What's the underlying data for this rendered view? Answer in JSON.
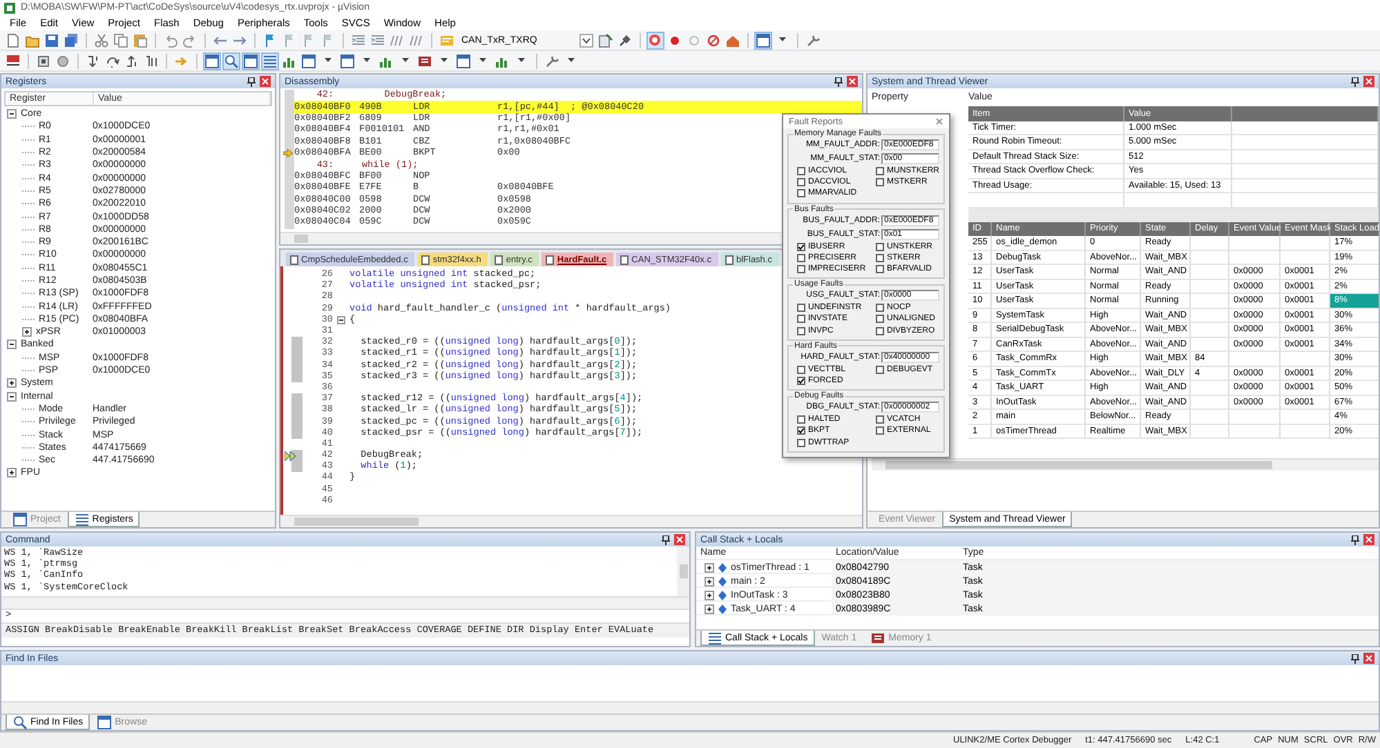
{
  "window": {
    "title": "D:\\MOBA\\SW\\FW\\PM-PT\\act\\CoDeSys\\source\\uV4\\codesys_rtx.uvprojx - µVision"
  },
  "menu": [
    "File",
    "Edit",
    "View",
    "Project",
    "Flash",
    "Debug",
    "Peripherals",
    "Tools",
    "SVCS",
    "Window",
    "Help"
  ],
  "toolbar": {
    "target": "CAN_TxR_TXRQ"
  },
  "registers": {
    "title": "Registers",
    "columns": [
      "Register",
      "Value"
    ],
    "groups": [
      {
        "name": "Core",
        "expanded": true,
        "children": [
          {
            "name": "R0",
            "value": "0x1000DCE0"
          },
          {
            "name": "R1",
            "value": "0x00000001"
          },
          {
            "name": "R2",
            "value": "0x20000584"
          },
          {
            "name": "R3",
            "value": "0x00000000"
          },
          {
            "name": "R4",
            "value": "0x00000000"
          },
          {
            "name": "R5",
            "value": "0x02780000"
          },
          {
            "name": "R6",
            "value": "0x20022010"
          },
          {
            "name": "R7",
            "value": "0x1000DD58"
          },
          {
            "name": "R8",
            "value": "0x00000000"
          },
          {
            "name": "R9",
            "value": "0x200161BC"
          },
          {
            "name": "R10",
            "value": "0x00000000"
          },
          {
            "name": "R11",
            "value": "0x080455C1"
          },
          {
            "name": "R12",
            "value": "0x0804503B"
          },
          {
            "name": "R13 (SP)",
            "value": "0x1000FDF8"
          },
          {
            "name": "R14 (LR)",
            "value": "0xFFFFFFED"
          },
          {
            "name": "R15 (PC)",
            "value": "0x08040BFA"
          },
          {
            "name": "xPSR",
            "value": "0x01000003",
            "expanded": false
          }
        ]
      },
      {
        "name": "Banked",
        "expanded": true,
        "children": [
          {
            "name": "MSP",
            "value": "0x1000FDF8"
          },
          {
            "name": "PSP",
            "value": "0x1000DCE0"
          }
        ]
      },
      {
        "name": "System",
        "expanded": false
      },
      {
        "name": "Internal",
        "expanded": true,
        "children": [
          {
            "name": "Mode",
            "value": "Handler"
          },
          {
            "name": "Privilege",
            "value": "Privileged"
          },
          {
            "name": "Stack",
            "value": "MSP"
          },
          {
            "name": "States",
            "value": "4474175669"
          },
          {
            "name": "Sec",
            "value": "447.41756690"
          }
        ]
      },
      {
        "name": "FPU",
        "expanded": false
      }
    ],
    "tabs": [
      {
        "label": "Project",
        "selected": false
      },
      {
        "label": "Registers",
        "selected": true
      }
    ]
  },
  "disassembly": {
    "title": "Disassembly",
    "lines": [
      {
        "kind": "source",
        "text": "    42:         DebugBreak;"
      },
      {
        "kind": "instruction",
        "address": "0x08040BF0",
        "opcode": "490B",
        "mnemonic": "LDR",
        "operands": "r1,[pc,#44]  ; @0x08040C20",
        "highlighted": true,
        "current": false
      },
      {
        "kind": "instruction",
        "address": "0x08040BF2",
        "opcode": "6809",
        "mnemonic": "LDR",
        "operands": "r1,[r1,#0x00]",
        "highlighted": false,
        "current": false
      },
      {
        "kind": "instruction",
        "address": "0x08040BF4",
        "opcode": "F0010101",
        "mnemonic": "AND",
        "operands": "r1,r1,#0x01",
        "highlighted": false,
        "current": false
      },
      {
        "kind": "instruction",
        "address": "0x08040BF8",
        "opcode": "B101",
        "mnemonic": "CBZ",
        "operands": "r1,0x08040BFC",
        "highlighted": false,
        "current": false
      },
      {
        "kind": "instruction",
        "address": "0x08040BFA",
        "opcode": "BE00",
        "mnemonic": "BKPT",
        "operands": "0x00",
        "highlighted": false,
        "current": true
      },
      {
        "kind": "source",
        "text": "    43:     while (1);"
      },
      {
        "kind": "instruction",
        "address": "0x08040BFC",
        "opcode": "BF00",
        "mnemonic": "NOP",
        "highlighted": false,
        "current": false
      },
      {
        "kind": "instruction",
        "address": "0x08040BFE",
        "opcode": "E7FE",
        "mnemonic": "B",
        "operands": "0x08040BFE",
        "highlighted": false,
        "current": false
      },
      {
        "kind": "instruction",
        "address": "0x08040C00",
        "opcode": "0598",
        "mnemonic": "DCW",
        "operands": "0x0598",
        "highlighted": false,
        "current": false
      },
      {
        "kind": "instruction",
        "address": "0x08040C02",
        "opcode": "2000",
        "mnemonic": "DCW",
        "operands": "0x2000",
        "highlighted": false,
        "current": false
      },
      {
        "kind": "instruction",
        "address": "0x08040C04",
        "opcode": "059C",
        "mnemonic": "DCW",
        "operands": "0x059C",
        "highlighted": false,
        "current": false
      }
    ]
  },
  "editor": {
    "tabs": [
      {
        "label": "CmpScheduleEmbedded.c",
        "color": "#c9d0ea",
        "selected": false
      },
      {
        "label": "stm32f4xx.h",
        "color": "#f6dc7e",
        "selected": false
      },
      {
        "label": "entry.c",
        "color": "#cfe2bd",
        "selected": false
      },
      {
        "label": "HardFault.c",
        "color": "#f0b4b4",
        "selected": true
      },
      {
        "label": "CAN_STM32F40x.c",
        "color": "#d9c9ea",
        "selected": false
      },
      {
        "label": "blFlash.c",
        "color": "#c8e4e0",
        "selected": false
      }
    ],
    "lines": [
      {
        "number": "26",
        "segments": [
          {
            "text": "volatile unsigned int",
            "kind": "keyword"
          },
          {
            "text": " stacked_pc;",
            "kind": "plain"
          }
        ],
        "executed": false,
        "current": false,
        "fold": false
      },
      {
        "number": "27",
        "segments": [
          {
            "text": "volatile unsigned int",
            "kind": "keyword"
          },
          {
            "text": " stacked_psr;",
            "kind": "plain"
          }
        ],
        "executed": false,
        "current": false,
        "fold": false
      },
      {
        "number": "28",
        "executed": false,
        "current": false,
        "fold": false
      },
      {
        "number": "29",
        "segments": [
          {
            "text": "void",
            "kind": "keyword"
          },
          {
            "text": " hard_fault_handler_c (",
            "kind": "plain"
          },
          {
            "text": "unsigned int",
            "kind": "keyword"
          },
          {
            "text": " * hardfault_args)",
            "kind": "plain"
          }
        ],
        "executed": false,
        "current": false,
        "fold": false
      },
      {
        "number": "30",
        "segments": [
          {
            "text": "{",
            "kind": "plain"
          }
        ],
        "executed": false,
        "current": false,
        "fold": true
      },
      {
        "number": "31",
        "executed": false,
        "current": false,
        "fold": false
      },
      {
        "number": "32",
        "segments": [
          {
            "text": "  stacked_r0 = ((",
            "kind": "plain"
          },
          {
            "text": "unsigned long",
            "kind": "keyword"
          },
          {
            "text": ") hardfault_args[",
            "kind": "plain"
          },
          {
            "text": "0",
            "kind": "number"
          },
          {
            "text": "]);",
            "kind": "plain"
          }
        ],
        "executed": true,
        "current": false,
        "fold": false
      },
      {
        "number": "33",
        "segments": [
          {
            "text": "  stacked_r1 = ((",
            "kind": "plain"
          },
          {
            "text": "unsigned long",
            "kind": "keyword"
          },
          {
            "text": ") hardfault_args[",
            "kind": "plain"
          },
          {
            "text": "1",
            "kind": "number"
          },
          {
            "text": "]);",
            "kind": "plain"
          }
        ],
        "executed": true,
        "current": false,
        "fold": false
      },
      {
        "number": "34",
        "segments": [
          {
            "text": "  stacked_r2 = ((",
            "kind": "plain"
          },
          {
            "text": "unsigned long",
            "kind": "keyword"
          },
          {
            "text": ") hardfault_args[",
            "kind": "plain"
          },
          {
            "text": "2",
            "kind": "number"
          },
          {
            "text": "]);",
            "kind": "plain"
          }
        ],
        "executed": true,
        "current": false,
        "fold": false
      },
      {
        "number": "35",
        "segments": [
          {
            "text": "  stacked_r3 = ((",
            "kind": "plain"
          },
          {
            "text": "unsigned long",
            "kind": "keyword"
          },
          {
            "text": ") hardfault_args[",
            "kind": "plain"
          },
          {
            "text": "3",
            "kind": "number"
          },
          {
            "text": "]);",
            "kind": "plain"
          }
        ],
        "executed": true,
        "current": false,
        "fold": false
      },
      {
        "number": "36",
        "executed": false,
        "current": false,
        "fold": false
      },
      {
        "number": "37",
        "segments": [
          {
            "text": "  stacked_r12 = ((",
            "kind": "plain"
          },
          {
            "text": "unsigned long",
            "kind": "keyword"
          },
          {
            "text": ") hardfault_args[",
            "kind": "plain"
          },
          {
            "text": "4",
            "kind": "number"
          },
          {
            "text": "]);",
            "kind": "plain"
          }
        ],
        "executed": true,
        "current": false,
        "fold": false
      },
      {
        "number": "38",
        "segments": [
          {
            "text": "  stacked_lr = ((",
            "kind": "plain"
          },
          {
            "text": "unsigned long",
            "kind": "keyword"
          },
          {
            "text": ") hardfault_args[",
            "kind": "plain"
          },
          {
            "text": "5",
            "kind": "number"
          },
          {
            "text": "]);",
            "kind": "plain"
          }
        ],
        "executed": true,
        "current": false,
        "fold": false
      },
      {
        "number": "39",
        "segments": [
          {
            "text": "  stacked_pc = ((",
            "kind": "plain"
          },
          {
            "text": "unsigned long",
            "kind": "keyword"
          },
          {
            "text": ") hardfault_args[",
            "kind": "plain"
          },
          {
            "text": "6",
            "kind": "number"
          },
          {
            "text": "]);",
            "kind": "plain"
          }
        ],
        "executed": true,
        "current": false,
        "fold": false
      },
      {
        "number": "40",
        "segments": [
          {
            "text": "  stacked_psr = ((",
            "kind": "plain"
          },
          {
            "text": "unsigned long",
            "kind": "keyword"
          },
          {
            "text": ") hardfault_args[",
            "kind": "plain"
          },
          {
            "text": "7",
            "kind": "number"
          },
          {
            "text": "]);",
            "kind": "plain"
          }
        ],
        "executed": true,
        "current": false,
        "fold": false
      },
      {
        "number": "41",
        "executed": false,
        "current": false,
        "fold": false
      },
      {
        "number": "42",
        "segments": [
          {
            "text": "  DebugBreak;",
            "kind": "plain"
          }
        ],
        "executed": true,
        "current": true,
        "fold": false
      },
      {
        "number": "43",
        "segments": [
          {
            "text": "  while",
            "kind": "keyword"
          },
          {
            "text": " (",
            "kind": "plain"
          },
          {
            "text": "1",
            "kind": "number"
          },
          {
            "text": ");",
            "kind": "plain"
          }
        ],
        "executed": true,
        "current": false,
        "fold": false
      },
      {
        "number": "44",
        "segments": [
          {
            "text": "}",
            "kind": "plain"
          }
        ],
        "executed": false,
        "current": false,
        "fold": false
      },
      {
        "number": "45",
        "executed": false,
        "current": false,
        "fold": false
      },
      {
        "number": "46",
        "executed": false,
        "current": false,
        "fold": false
      }
    ]
  },
  "fault_reports": {
    "title": "Fault Reports",
    "groups": [
      {
        "title": "Memory Manage Faults",
        "registers": [
          {
            "label": "MM_FAULT_ADDR:",
            "value": "0xE000EDF8"
          },
          {
            "label": "MM_FAULT_STAT:",
            "value": "0x00"
          }
        ],
        "flags": [
          {
            "label": "IACCVIOL",
            "checked": false
          },
          {
            "label": "MUNSTKERR",
            "checked": false
          },
          {
            "label": "DACCVIOL",
            "checked": false
          },
          {
            "label": "MSTKERR",
            "checked": false
          },
          {
            "label": "MMARVALID",
            "checked": false
          }
        ]
      },
      {
        "title": "Bus Faults",
        "registers": [
          {
            "label": "BUS_FAULT_ADDR:",
            "value": "0xE000EDF8"
          },
          {
            "label": "BUS_FAULT_STAT:",
            "value": "0x01"
          }
        ],
        "flags": [
          {
            "label": "IBUSERR",
            "checked": true
          },
          {
            "label": "UNSTKERR",
            "checked": false
          },
          {
            "label": "PRECISERR",
            "checked": false
          },
          {
            "label": "STKERR",
            "checked": false
          },
          {
            "label": "IMPRECISERR",
            "checked": false
          },
          {
            "label": "BFARVALID",
            "checked": false
          }
        ]
      },
      {
        "title": "Usage Faults",
        "registers": [
          {
            "label": "USG_FAULT_STAT:",
            "value": "0x0000"
          }
        ],
        "flags": [
          {
            "label": "UNDEFINSTR",
            "checked": false
          },
          {
            "label": "NOCP",
            "checked": false
          },
          {
            "label": "INVSTATE",
            "checked": false
          },
          {
            "label": "UNALIGNED",
            "checked": false
          },
          {
            "label": "INVPC",
            "checked": false
          },
          {
            "label": "DIVBYZERO",
            "checked": false
          }
        ]
      },
      {
        "title": "Hard Faults",
        "registers": [
          {
            "label": "HARD_FAULT_STAT:",
            "value": "0x40000000"
          }
        ],
        "flags": [
          {
            "label": "VECTTBL",
            "checked": false
          },
          {
            "label": "DEBUGEVT",
            "checked": false
          },
          {
            "label": "FORCED",
            "checked": true
          }
        ]
      },
      {
        "title": "Debug Faults",
        "registers": [
          {
            "label": "DBG_FAULT_STAT:",
            "value": "0x00000002"
          }
        ],
        "flags": [
          {
            "label": "HALTED",
            "checked": false
          },
          {
            "label": "VCATCH",
            "checked": false
          },
          {
            "label": "BKPT",
            "checked": true
          },
          {
            "label": "EXTERNAL",
            "checked": false
          },
          {
            "label": "DWTTRAP",
            "checked": false
          }
        ]
      }
    ]
  },
  "thread_viewer": {
    "title": "System and Thread Viewer",
    "columns": [
      "Property",
      "Value"
    ],
    "system": {
      "columns": [
        "Item",
        "Value"
      ],
      "rows": [
        {
          "item": "Tick Timer:",
          "value": "1.000 mSec"
        },
        {
          "item": "Round Robin Timeout:",
          "value": "5.000 mSec"
        },
        {
          "item": "Default Thread Stack Size:",
          "value": "512"
        },
        {
          "item": "Thread Stack Overflow Check:",
          "value": "Yes"
        },
        {
          "item": "Thread Usage:",
          "value": "Available: 15, Used: 13"
        }
      ]
    },
    "threads": {
      "columns": [
        "ID",
        "Name",
        "Priority",
        "State",
        "Delay",
        "Event Value",
        "Event Mask",
        "Stack Load"
      ],
      "rows": [
        {
          "id": "255",
          "name": "os_idle_demon",
          "priority": "0",
          "state": "Ready",
          "stack_load": "17%",
          "highlighted": false
        },
        {
          "id": "13",
          "name": "DebugTask",
          "priority": "AboveNor...",
          "state": "Wait_MBX",
          "stack_load": "19%",
          "highlighted": false
        },
        {
          "id": "12",
          "name": "UserTask",
          "priority": "Normal",
          "state": "Wait_AND",
          "event_value": "0x0000",
          "event_mask": "0x0001",
          "stack_load": "2%",
          "highlighted": false
        },
        {
          "id": "11",
          "name": "UserTask",
          "priority": "Normal",
          "state": "Ready",
          "event_value": "0x0000",
          "event_mask": "0x0001",
          "stack_load": "2%",
          "highlighted": false
        },
        {
          "id": "10",
          "name": "UserTask",
          "priority": "Normal",
          "state": "Running",
          "event_value": "0x0000",
          "event_mask": "0x0001",
          "stack_load": "8%",
          "highlighted": true
        },
        {
          "id": "9",
          "name": "SystemTask",
          "priority": "High",
          "state": "Wait_AND",
          "event_value": "0x0000",
          "event_mask": "0x0001",
          "stack_load": "30%",
          "highlighted": false
        },
        {
          "id": "8",
          "name": "SerialDebugTask",
          "priority": "AboveNor...",
          "state": "Wait_MBX",
          "event_value": "0x0000",
          "event_mask": "0x0001",
          "stack_load": "36%",
          "highlighted": false
        },
        {
          "id": "7",
          "name": "CanRxTask",
          "priority": "AboveNor...",
          "state": "Wait_AND",
          "event_value": "0x0000",
          "event_mask": "0x0001",
          "stack_load": "34%",
          "highlighted": false
        },
        {
          "id": "6",
          "name": "Task_CommRx",
          "priority": "High",
          "state": "Wait_MBX",
          "delay": "84",
          "stack_load": "30%",
          "highlighted": false
        },
        {
          "id": "5",
          "name": "Task_CommTx",
          "priority": "AboveNor...",
          "state": "Wait_DLY",
          "delay": "4",
          "event_value": "0x0000",
          "event_mask": "0x0001",
          "stack_load": "20%",
          "highlighted": false
        },
        {
          "id": "4",
          "name": "Task_UART",
          "priority": "High",
          "state": "Wait_AND",
          "event_value": "0x0000",
          "event_mask": "0x0001",
          "stack_load": "50%",
          "highlighted": false
        },
        {
          "id": "3",
          "name": "InOutTask",
          "priority": "AboveNor...",
          "state": "Wait_AND",
          "event_value": "0x0000",
          "event_mask": "0x0001",
          "stack_load": "67%",
          "highlighted": false
        },
        {
          "id": "2",
          "name": "main",
          "priority": "BelowNor...",
          "state": "Ready",
          "stack_load": "4%",
          "highlighted": false
        },
        {
          "id": "1",
          "name": "osTimerThread",
          "priority": "Realtime",
          "state": "Wait_MBX",
          "stack_load": "20%",
          "highlighted": false
        }
      ]
    },
    "tabs": [
      {
        "label": "Event Viewer",
        "selected": false
      },
      {
        "label": "System and Thread Viewer",
        "selected": true
      }
    ]
  },
  "command": {
    "title": "Command",
    "lines": [
      "WS 1, `RawSize",
      "WS 1, `ptrmsg",
      "WS 1, `CanInfo",
      "WS 1, `SystemCoreClock"
    ],
    "prompt": ">",
    "hint": "ASSIGN BreakDisable BreakEnable BreakKill BreakList BreakSet BreakAccess COVERAGE DEFINE DIR Display Enter EVALuate"
  },
  "call_stack": {
    "title": "Call Stack + Locals",
    "columns": [
      "Name",
      "Location/Value",
      "Type"
    ],
    "rows": [
      {
        "name": "osTimerThread : 1",
        "location": "0x08042790",
        "type": "Task",
        "expanded": false
      },
      {
        "name": "main : 2",
        "location": "0x0804189C",
        "type": "Task",
        "expanded": false
      },
      {
        "name": "InOutTask : 3",
        "location": "0x08023B80",
        "type": "Task",
        "expanded": false
      },
      {
        "name": "Task_UART : 4",
        "location": "0x0803989C",
        "type": "Task",
        "expanded": false
      }
    ],
    "tabs": [
      {
        "label": "Call Stack + Locals",
        "selected": true
      },
      {
        "label": "Watch 1",
        "selected": false
      },
      {
        "label": "Memory 1",
        "selected": false
      }
    ]
  },
  "find_in_files": {
    "title": "Find In Files",
    "tabs": [
      {
        "label": "Find In Files",
        "selected": true
      },
      {
        "label": "Browse",
        "selected": false
      }
    ]
  },
  "status_bar": {
    "debugger": "ULINK2/ME Cortex Debugger",
    "time": "t1: 447.41756690 sec",
    "position": "L:42 C:1",
    "indicators": [
      "CAP",
      "NUM",
      "SCRL",
      "OVR",
      "R/W"
    ]
  }
}
